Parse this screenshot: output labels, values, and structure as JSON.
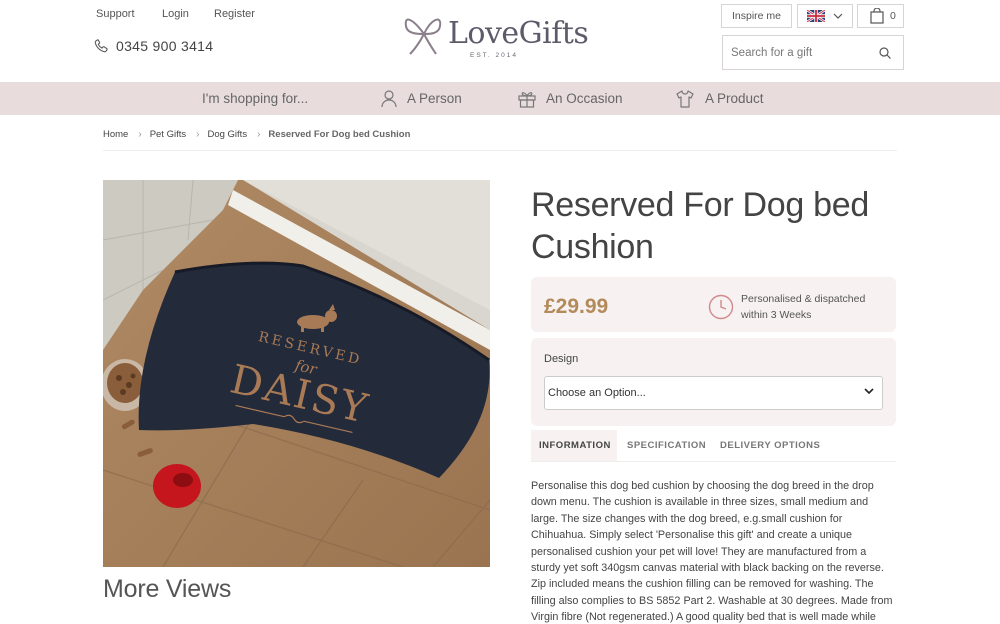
{
  "header": {
    "links": [
      "Support",
      "Login",
      "Register"
    ],
    "phone": "0345 900 3414",
    "logo": {
      "brand": "LoveGifts",
      "est": "EST. 2014"
    },
    "inspire_label": "Inspire me",
    "cart_count": "0",
    "search_placeholder": "Search for a gift"
  },
  "nav": {
    "lead": "I'm shopping for...",
    "items": [
      {
        "label": "A Person",
        "icon": "person-icon"
      },
      {
        "label": "An Occasion",
        "icon": "gift-icon"
      },
      {
        "label": "A Product",
        "icon": "shirt-icon"
      }
    ]
  },
  "breadcrumb": [
    "Home",
    "Pet Gifts",
    "Dog Gifts",
    "Reserved For Dog bed Cushion"
  ],
  "product": {
    "title": "Reserved For Dog bed Cushion",
    "price": "£29.99",
    "dispatch": "Personalised & dispatched within 3 Weeks",
    "cushion_text": {
      "line1": "RESERVED",
      "line2": "for",
      "line3": "DAISY"
    },
    "design_label": "Design",
    "design_selected": "Choose an Option...",
    "more_views": "More Views"
  },
  "tabs": [
    "INFORMATION",
    "SPECIFICATION",
    "DELIVERY OPTIONS"
  ],
  "description": "Personalise this dog bed cushion by choosing the dog breed in the drop down menu. The cushion is available in three sizes, small medium and large. The size changes with the dog breed, e.g.small cushion for Chihuahua. Simply select 'Personalise this gift' and create a unique personalised cushion your pet will love! They are manufactured from a sturdy yet soft 340gsm canvas material with black backing on the reverse. Zip included means the cushion filling can be removed for washing. The filling also complies to BS 5852 Part 2. Washable at 30 degrees. Made from Virgin fibre (Not regenerated.) A good quality bed that is well made while also being comfortable for your pup!",
  "colors": {
    "nav_bg": "#e8dcdc",
    "panel_bg": "#f7f1f1",
    "price": "#b38a5a",
    "clock": "#d08a8a",
    "cushion": "#232a3a",
    "cushion_text": "#a97a56"
  }
}
